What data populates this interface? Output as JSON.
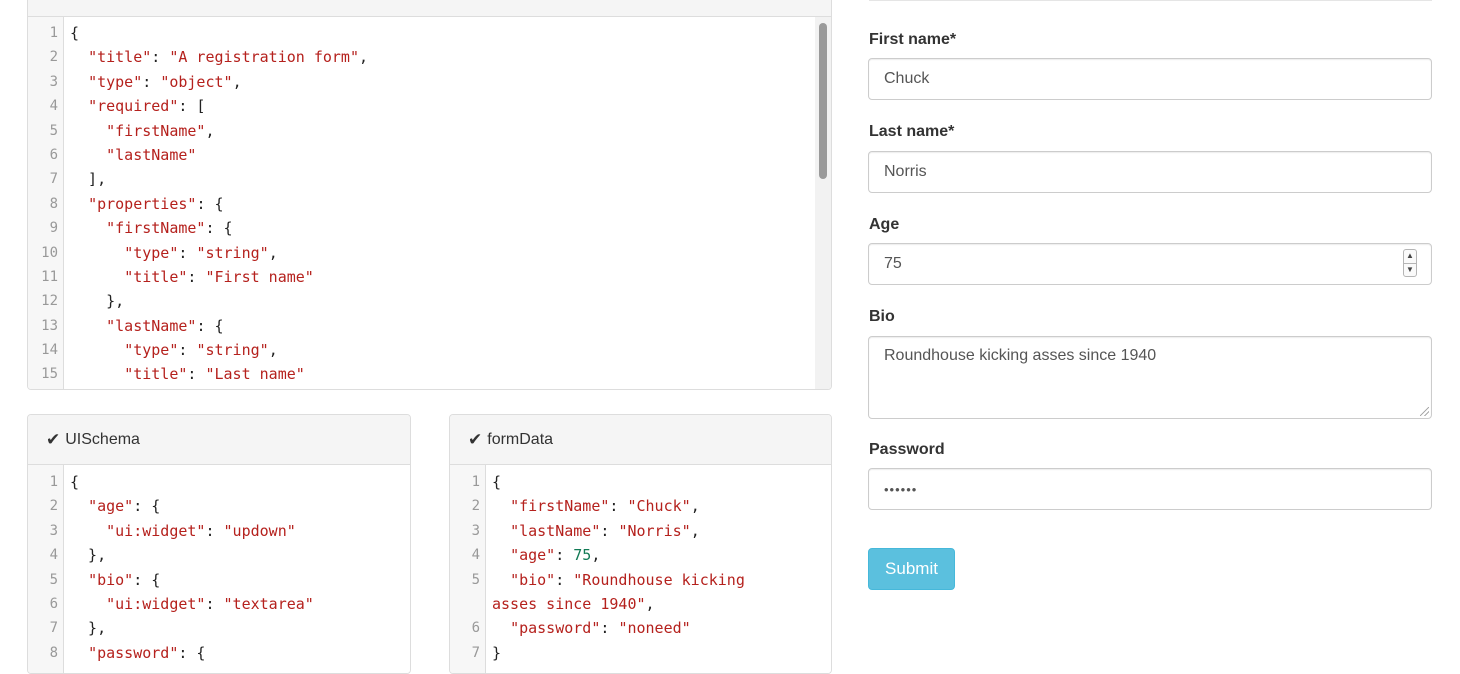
{
  "schema_editor": {
    "lines": [
      [
        [
          "",
          "{"
        ]
      ],
      [
        [
          "",
          "  "
        ],
        [
          "s",
          "\"title\""
        ],
        [
          "",
          ": "
        ],
        [
          "s",
          "\"A registration form\""
        ],
        [
          "",
          ","
        ]
      ],
      [
        [
          "",
          "  "
        ],
        [
          "s",
          "\"type\""
        ],
        [
          "",
          ": "
        ],
        [
          "s",
          "\"object\""
        ],
        [
          "",
          ","
        ]
      ],
      [
        [
          "",
          "  "
        ],
        [
          "s",
          "\"required\""
        ],
        [
          "",
          ": ["
        ]
      ],
      [
        [
          "",
          "    "
        ],
        [
          "s",
          "\"firstName\""
        ],
        [
          "",
          ","
        ]
      ],
      [
        [
          "",
          "    "
        ],
        [
          "s",
          "\"lastName\""
        ]
      ],
      [
        [
          "",
          "  ],"
        ]
      ],
      [
        [
          "",
          "  "
        ],
        [
          "s",
          "\"properties\""
        ],
        [
          "",
          ": {"
        ]
      ],
      [
        [
          "",
          "    "
        ],
        [
          "s",
          "\"firstName\""
        ],
        [
          "",
          ": {"
        ]
      ],
      [
        [
          "",
          "      "
        ],
        [
          "s",
          "\"type\""
        ],
        [
          "",
          ": "
        ],
        [
          "s",
          "\"string\""
        ],
        [
          "",
          ","
        ]
      ],
      [
        [
          "",
          "      "
        ],
        [
          "s",
          "\"title\""
        ],
        [
          "",
          ": "
        ],
        [
          "s",
          "\"First name\""
        ]
      ],
      [
        [
          "",
          "    },"
        ]
      ],
      [
        [
          "",
          "    "
        ],
        [
          "s",
          "\"lastName\""
        ],
        [
          "",
          ": {"
        ]
      ],
      [
        [
          "",
          "      "
        ],
        [
          "s",
          "\"type\""
        ],
        [
          "",
          ": "
        ],
        [
          "s",
          "\"string\""
        ],
        [
          "",
          ","
        ]
      ],
      [
        [
          "",
          "      "
        ],
        [
          "s",
          "\"title\""
        ],
        [
          "",
          ": "
        ],
        [
          "s",
          "\"Last name\""
        ]
      ]
    ]
  },
  "uischema_panel": {
    "title": "UISchema",
    "icon": "check-icon",
    "lines": [
      [
        [
          "",
          "{"
        ]
      ],
      [
        [
          "",
          "  "
        ],
        [
          "s",
          "\"age\""
        ],
        [
          "",
          ": {"
        ]
      ],
      [
        [
          "",
          "    "
        ],
        [
          "s",
          "\"ui:widget\""
        ],
        [
          "",
          ": "
        ],
        [
          "s",
          "\"updown\""
        ]
      ],
      [
        [
          "",
          "  },"
        ]
      ],
      [
        [
          "",
          "  "
        ],
        [
          "s",
          "\"bio\""
        ],
        [
          "",
          ": {"
        ]
      ],
      [
        [
          "",
          "    "
        ],
        [
          "s",
          "\"ui:widget\""
        ],
        [
          "",
          ": "
        ],
        [
          "s",
          "\"textarea\""
        ]
      ],
      [
        [
          "",
          "  },"
        ]
      ],
      [
        [
          "",
          "  "
        ],
        [
          "s",
          "\"password\""
        ],
        [
          "",
          ": {"
        ]
      ]
    ]
  },
  "formdata_panel": {
    "title": "formData",
    "icon": "check-icon",
    "lines": [
      [
        [
          "",
          "{"
        ]
      ],
      [
        [
          "",
          "  "
        ],
        [
          "s",
          "\"firstName\""
        ],
        [
          "",
          ": "
        ],
        [
          "s",
          "\"Chuck\""
        ],
        [
          "",
          ","
        ]
      ],
      [
        [
          "",
          "  "
        ],
        [
          "s",
          "\"lastName\""
        ],
        [
          "",
          ": "
        ],
        [
          "s",
          "\"Norris\""
        ],
        [
          "",
          ","
        ]
      ],
      [
        [
          "",
          "  "
        ],
        [
          "s",
          "\"age\""
        ],
        [
          "",
          ": "
        ],
        [
          "n",
          "75"
        ],
        [
          "",
          ","
        ]
      ],
      [
        [
          "",
          "  "
        ],
        [
          "s",
          "\"bio\""
        ],
        [
          "",
          ": "
        ],
        [
          "s",
          "\"Roundhouse kicking"
        ]
      ],
      [
        [
          "s",
          "asses since 1940\""
        ],
        [
          "",
          ","
        ]
      ],
      [
        [
          "",
          "  "
        ],
        [
          "s",
          "\"password\""
        ],
        [
          "",
          ": "
        ],
        [
          "s",
          "\"noneed\""
        ]
      ],
      [
        [
          "",
          "}"
        ]
      ]
    ],
    "line_numbers": [
      "1",
      "2",
      "3",
      "4",
      "5",
      "",
      "6",
      "7"
    ]
  },
  "form": {
    "first_name": {
      "label": "First name*",
      "value": "Chuck"
    },
    "last_name": {
      "label": "Last name*",
      "value": "Norris"
    },
    "age": {
      "label": "Age",
      "value": "75"
    },
    "bio": {
      "label": "Bio",
      "value": "Roundhouse kicking asses since 1940"
    },
    "password": {
      "label": "Password",
      "value": "••••••"
    },
    "submit_label": "Submit"
  },
  "colors": {
    "string_token": "#b5211d",
    "number_token": "#117a55",
    "submit_button": "#5bc0de"
  }
}
